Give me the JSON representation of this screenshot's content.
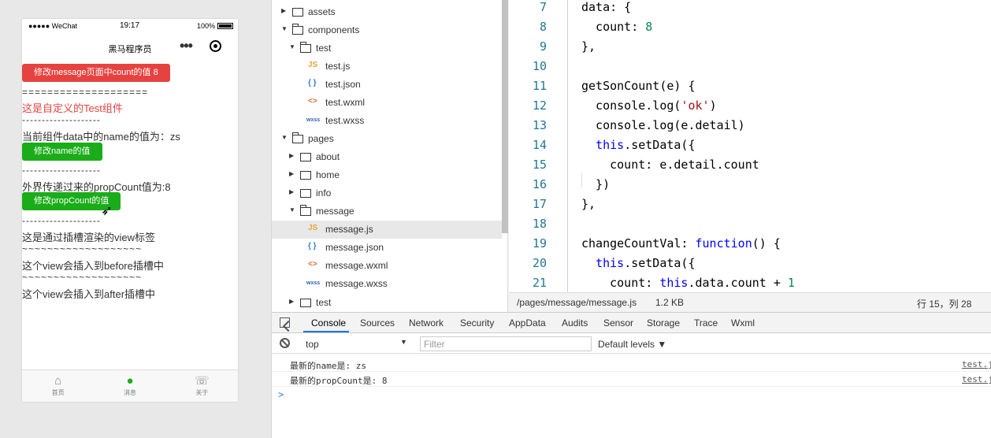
{
  "simulator": {
    "status": {
      "signal": "●●●●● WeChat",
      "time": "19:17",
      "battery": "100%"
    },
    "nav_title": "黑马程序员",
    "button_update_count": "修改message页面中count的值 8",
    "separator_eq": "====================",
    "component_title": "这是自定义的Test组件",
    "separator_dash": "--------------------",
    "name_text": "当前组件data中的name的值为：zs",
    "button_update_name": "修改name的值",
    "prop_text": "外界传递过来的propCount值为:8",
    "button_update_prop": "修改propCount的值",
    "slot_view_text": "这是通过插槽渲染的view标签",
    "separator_tilde": "~~~~~~~~~~~~~~~~~~~",
    "before_text": "这个view会插入到before插槽中",
    "after_text": "这个view会插入到after插槽中",
    "tabs": [
      {
        "label": "首页",
        "icon": "⌂"
      },
      {
        "label": "消息",
        "icon": "●"
      },
      {
        "label": "关于",
        "icon": "☏"
      }
    ]
  },
  "filetree": {
    "items": [
      {
        "name": "assets"
      },
      {
        "name": "components"
      },
      {
        "name": "test"
      },
      {
        "name": "test.js",
        "icon": "JS"
      },
      {
        "name": "test.json",
        "icon": "{ }"
      },
      {
        "name": "test.wxml",
        "icon": "<>"
      },
      {
        "name": "test.wxss",
        "icon": "wxss"
      },
      {
        "name": "pages"
      },
      {
        "name": "about"
      },
      {
        "name": "home"
      },
      {
        "name": "info"
      },
      {
        "name": "message"
      },
      {
        "name": "message.js",
        "icon": "JS"
      },
      {
        "name": "message.json",
        "icon": "{ }"
      },
      {
        "name": "message.wxml",
        "icon": "<>"
      },
      {
        "name": "message.wxss",
        "icon": "wxss"
      },
      {
        "name": "test"
      }
    ]
  },
  "editor": {
    "lines": [
      {
        "n": "7"
      },
      {
        "n": "8"
      },
      {
        "n": "9"
      },
      {
        "n": "10"
      },
      {
        "n": "11"
      },
      {
        "n": "12"
      },
      {
        "n": "13"
      },
      {
        "n": "14"
      },
      {
        "n": "15"
      },
      {
        "n": "16"
      },
      {
        "n": "17"
      },
      {
        "n": "18"
      },
      {
        "n": "19"
      },
      {
        "n": "20"
      },
      {
        "n": "21"
      }
    ],
    "code": {
      "l7": "data: {",
      "l8a": "  count: ",
      "l8b": "8",
      "l9": "},",
      "l11": "getSonCount(e) {",
      "l12a": "  console.log(",
      "l12b": "'ok'",
      "l12c": ")",
      "l13": "  console.log(e.detail)",
      "l14a": "  ",
      "l14b": "this",
      "l14c": ".setData({",
      "l15": "    count: e.detail.count",
      "l16": "  })",
      "l17": "},",
      "l19a": "changeCountVal: ",
      "l19b": "function",
      "l19c": "() {",
      "l20a": "  ",
      "l20b": "this",
      "l20c": ".setData({",
      "l21a": "    count: ",
      "l21b": "this",
      "l21c": ".data.count + ",
      "l21d": "1"
    },
    "status": {
      "path": "/pages/message/message.js",
      "size": "1.2 KB",
      "position": "行 15，列 28"
    }
  },
  "devtools": {
    "tabs": [
      "Console",
      "Sources",
      "Network",
      "Security",
      "AppData",
      "Audits",
      "Sensor",
      "Storage",
      "Trace",
      "Wxml"
    ],
    "context": "top",
    "filter_placeholder": "Filter",
    "levels": "Default levels ▼",
    "logs": [
      {
        "msg": "最新的name是: zs",
        "src": "test.js"
      },
      {
        "msg": "最新的propCount是: 8",
        "src": "test.js"
      }
    ],
    "prompt": ">"
  }
}
